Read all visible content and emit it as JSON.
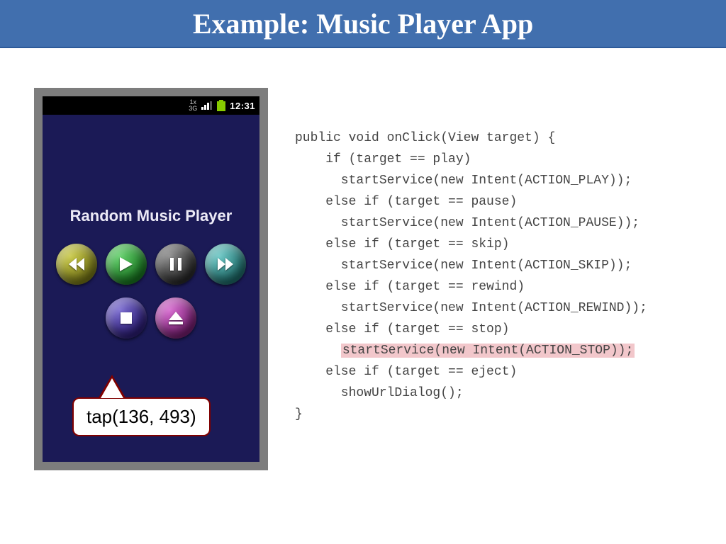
{
  "slide": {
    "title": "Example: Music Player App"
  },
  "phone": {
    "status": {
      "clock": "12:31"
    },
    "app_title": "Random Music Player",
    "callout": "tap(136, 493)"
  },
  "code": {
    "l1": "public void onClick(View target) {",
    "l2": "    if (target == play)",
    "l3": "      startService(new Intent(ACTION_PLAY));",
    "l4": "    else if (target == pause)",
    "l5": "      startService(new Intent(ACTION_PAUSE));",
    "l6": "    else if (target == skip)",
    "l7": "      startService(new Intent(ACTION_SKIP));",
    "l8": "    else if (target == rewind)",
    "l9": "      startService(new Intent(ACTION_REWIND));",
    "l10": "    else if (target == stop)",
    "l11_pre": "      ",
    "l11_hl": "startService(new Intent(ACTION_STOP));",
    "l12": "    else if (target == eject)",
    "l13": "      showUrlDialog();",
    "l14": "}"
  }
}
